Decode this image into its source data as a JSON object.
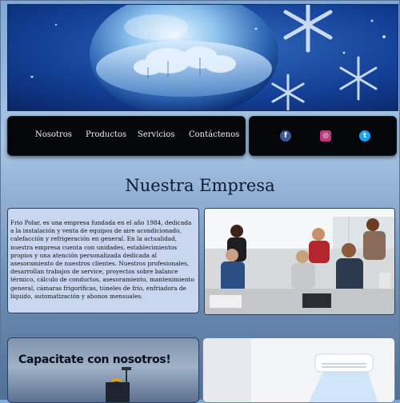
{
  "nav": {
    "items": [
      {
        "label": "Nosotros"
      },
      {
        "label": "Productos"
      },
      {
        "label": "Servicios"
      },
      {
        "label": "Contáctenos"
      }
    ]
  },
  "social": {
    "facebook": {
      "glyph": "f",
      "color": "#3b5998",
      "icon": "facebook-icon"
    },
    "instagram": {
      "glyph": "◎",
      "color": "#c13584",
      "icon": "instagram-icon"
    },
    "twitter": {
      "glyph": "t",
      "color": "#1da1f2",
      "icon": "twitter-icon"
    }
  },
  "section": {
    "title": "Nuestra Empresa"
  },
  "about": {
    "text": "Frio Polar, es una empresa fundada en el año 1984, dedicada a la instalación y venta de equipos de aire acondicionado, calefacción y refrigeración en general. En la actualidad, nuestra empresa cuenta con unidades, establecimientos propios y una atención personalizada dedicada al asesoramiento de nuestros clientes. Nuestros profesionales, desarrollan trabajos de service, proyectos sobre balance térmico, cálculo de conductos, asesoramiento, mantenimiento general, cámaras frigoríficas, túneles de frío, enfriadora de líquido, automatización y abonos mensuales."
  },
  "cards": {
    "training_title": "Capacitate con nosotros!"
  },
  "colors": {
    "nav_bg": "#050608",
    "about_bg": "#c8d6ef",
    "banner_blue": "#0d2a6b"
  }
}
